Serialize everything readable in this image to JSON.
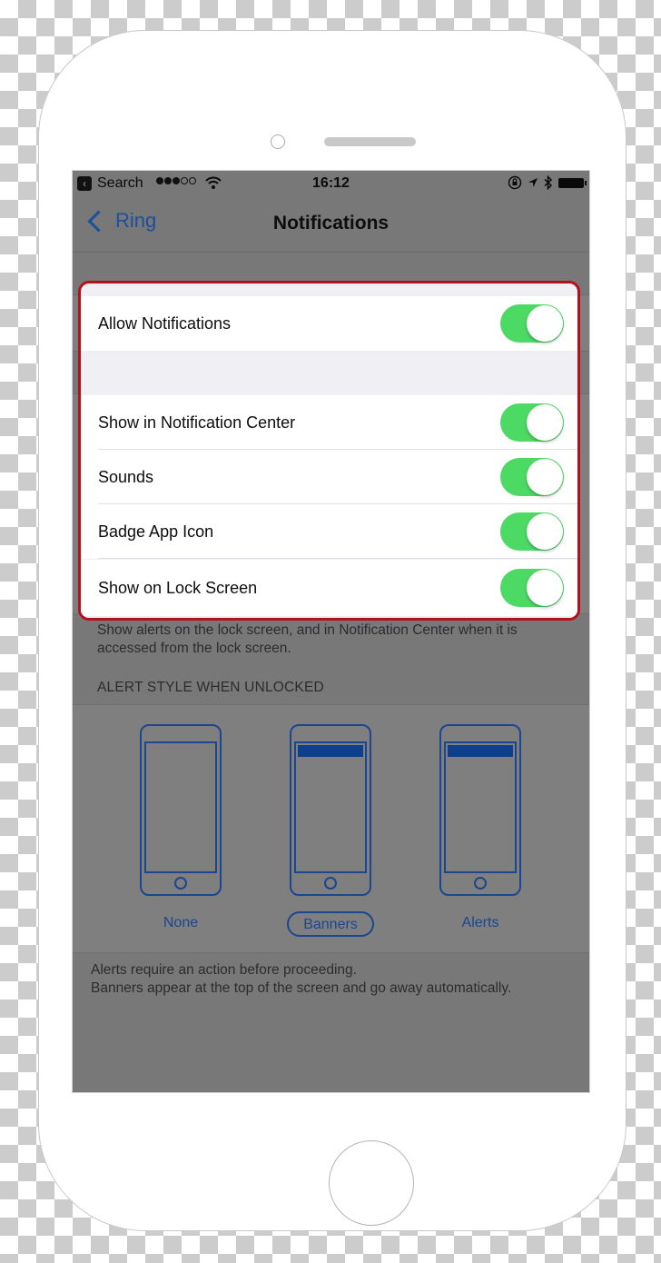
{
  "status_bar": {
    "back_app": "Search",
    "signal_bars_filled": 3,
    "signal_bars_total": 5,
    "time": "16:12",
    "icons": [
      "orientation-lock-icon",
      "location-icon",
      "bluetooth-icon",
      "battery-icon"
    ]
  },
  "nav": {
    "back_label": "Ring",
    "title": "Notifications"
  },
  "highlight_color": "#b3121c",
  "toggle_color": "#4cd964",
  "settings": {
    "allow": {
      "label": "Allow Notifications",
      "on": true
    },
    "items": [
      {
        "label": "Show in Notification Center",
        "on": true
      },
      {
        "label": "Sounds",
        "on": true
      },
      {
        "label": "Badge App Icon",
        "on": true
      },
      {
        "label": "Show on Lock Screen",
        "on": true
      }
    ],
    "lock_screen_note": "Show alerts on the lock screen, and in Notification Center when it is accessed from the lock screen."
  },
  "alert_style": {
    "header": "ALERT STYLE WHEN UNLOCKED",
    "options": [
      {
        "label": "None",
        "selected": false
      },
      {
        "label": "Banners",
        "selected": true
      },
      {
        "label": "Alerts",
        "selected": false
      }
    ],
    "note_line1": "Alerts require an action before proceeding.",
    "note_line2": "Banners appear at the top of the screen and go away automatically."
  }
}
